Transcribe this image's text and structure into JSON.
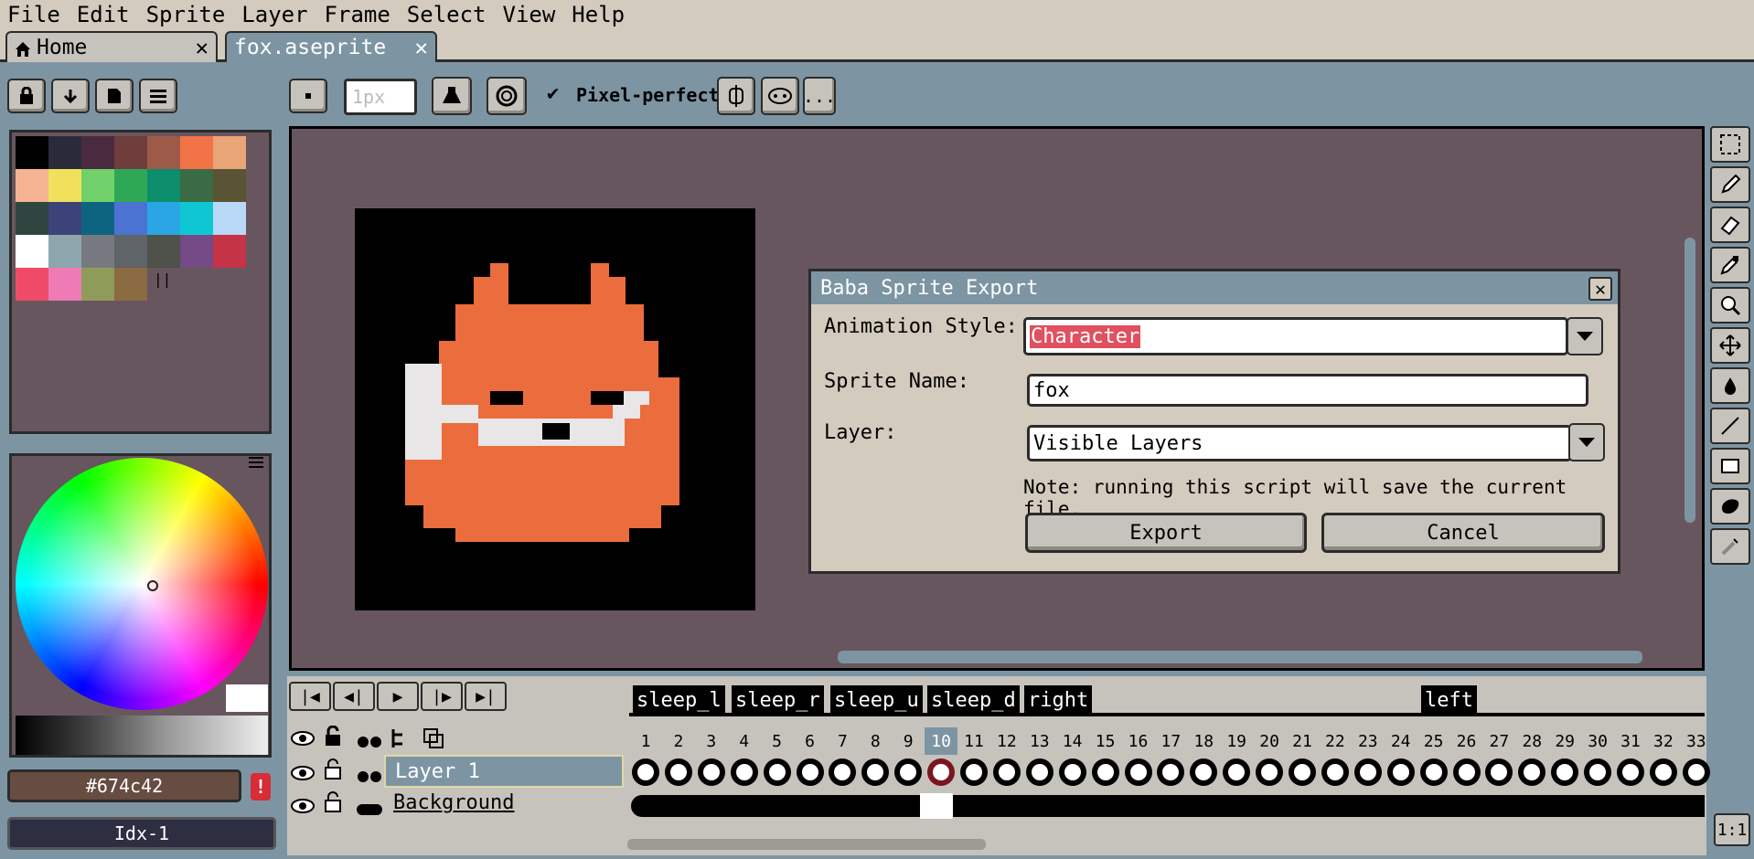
{
  "menu": [
    "File",
    "Edit",
    "Sprite",
    "Layer",
    "Frame",
    "Select",
    "View",
    "Help"
  ],
  "tabs": {
    "home": {
      "label": "Home",
      "close": "✕"
    },
    "fox": {
      "label": "fox.aseprite",
      "close": "✕"
    }
  },
  "toolbar": {
    "brush_size_placeholder": "1px",
    "pixel_perfect_check": "✔",
    "pixel_perfect_label": "Pixel-perfect",
    "more": "..."
  },
  "palette_colors": [
    "#000000",
    "#2b2a3a",
    "#4a2a3f",
    "#6f3e3c",
    "#9d5a48",
    "#f27446",
    "#e9a477",
    "#f6b393",
    "#f1e05c",
    "#71d16a",
    "#2fa856",
    "#0c8d6b",
    "#3a6b44",
    "#5a5434",
    "#304440",
    "#3c4378",
    "#0d6480",
    "#4b73d1",
    "#2ba6e5",
    "#0ec7d3",
    "#b9d8f7",
    "#ffffff",
    "#8ea6ae",
    "#777980",
    "#5f6468",
    "#4f514b",
    "#744b86",
    "#c43346",
    "#ef4b69",
    "#ee7ab6",
    "#8f9c59",
    "#8a6b42"
  ],
  "color_value": "#674c42",
  "color_index": "Idx-1",
  "dialog": {
    "title": "Baba Sprite Export",
    "close": "✕",
    "animation_style_label": "Animation Style:",
    "animation_style_value": "Character",
    "sprite_name_label": "Sprite Name:",
    "sprite_name_value": "fox",
    "layer_label": "Layer:",
    "layer_value": "Visible Layers",
    "note": "Note: running this script will save the current file.",
    "export": "Export",
    "cancel": "Cancel"
  },
  "timeline": {
    "tags": [
      "sleep_l",
      "sleep_r",
      "sleep_u",
      "sleep_d",
      "right",
      "left"
    ],
    "frames": [
      "1",
      "2",
      "3",
      "4",
      "5",
      "6",
      "7",
      "8",
      "9",
      "10",
      "11",
      "12",
      "13",
      "14",
      "15",
      "16",
      "17",
      "18",
      "19",
      "20",
      "21",
      "22",
      "23",
      "24",
      "25",
      "26",
      "27",
      "28",
      "29",
      "30",
      "31",
      "32",
      "33"
    ],
    "current_frame": "10",
    "layers": [
      "Layer 1",
      "Background"
    ],
    "zoom": "1:1"
  },
  "colors": {
    "accent": "#7d95a3",
    "canvas_bg": "#68565f",
    "fox_orange": "#eb6c3c",
    "fox_white": "#e8e6e6",
    "selected_frame": "#7a1620"
  }
}
